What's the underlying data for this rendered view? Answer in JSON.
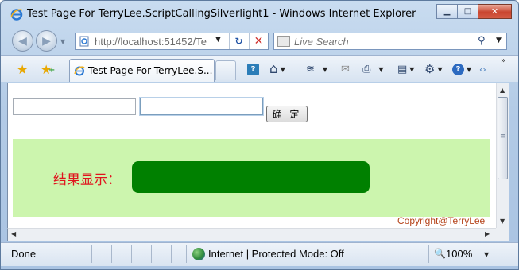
{
  "window": {
    "title": "Test Page For TerryLee.ScriptCallingSilverlight1 - Windows Internet Explorer",
    "min_glyph": "▁",
    "max_glyph": "□",
    "close_glyph": "✕"
  },
  "address_bar": {
    "back_glyph": "◀",
    "forward_glyph": "▶",
    "dropdown_glyph": "▼",
    "url": "http://localhost:51452/Te",
    "refresh_glyph": "↻",
    "stop_glyph": "✕"
  },
  "search": {
    "placeholder": "Live Search",
    "go_glyph": "⚲",
    "dropdown_glyph": "▼"
  },
  "tabs": {
    "active_label": "Test Page For TerryLee.S...",
    "favorites_glyph": "★",
    "add_favorites_glyph": "★"
  },
  "command_bar": {
    "home_glyph": "⌂",
    "feeds_glyph": "≋",
    "mail_glyph": "✉",
    "print_glyph": "⎙",
    "page_glyph": "▤",
    "tools_glyph": "⚙",
    "help_glyph": "?",
    "quick_glyph": "?",
    "research_glyph": "‹›",
    "dropdown_glyph": "▼",
    "more_glyph": "»"
  },
  "content": {
    "input1_value": "",
    "input2_value": "",
    "ok_button_label": "确 定",
    "result_label": "结果显示：",
    "copyright": "Copyright@TerryLee",
    "result_box_color": "#008000",
    "silverlight_bg": "#ccf5ae"
  },
  "scrollbars": {
    "up_glyph": "▲",
    "down_glyph": "▼",
    "left_glyph": "◀",
    "right_glyph": "▶"
  },
  "status_bar": {
    "status": "Done",
    "zone": "Internet | Protected Mode: Off",
    "zoom": "100%",
    "zoom_glyph": "🔍",
    "dropdown_glyph": "▼"
  }
}
